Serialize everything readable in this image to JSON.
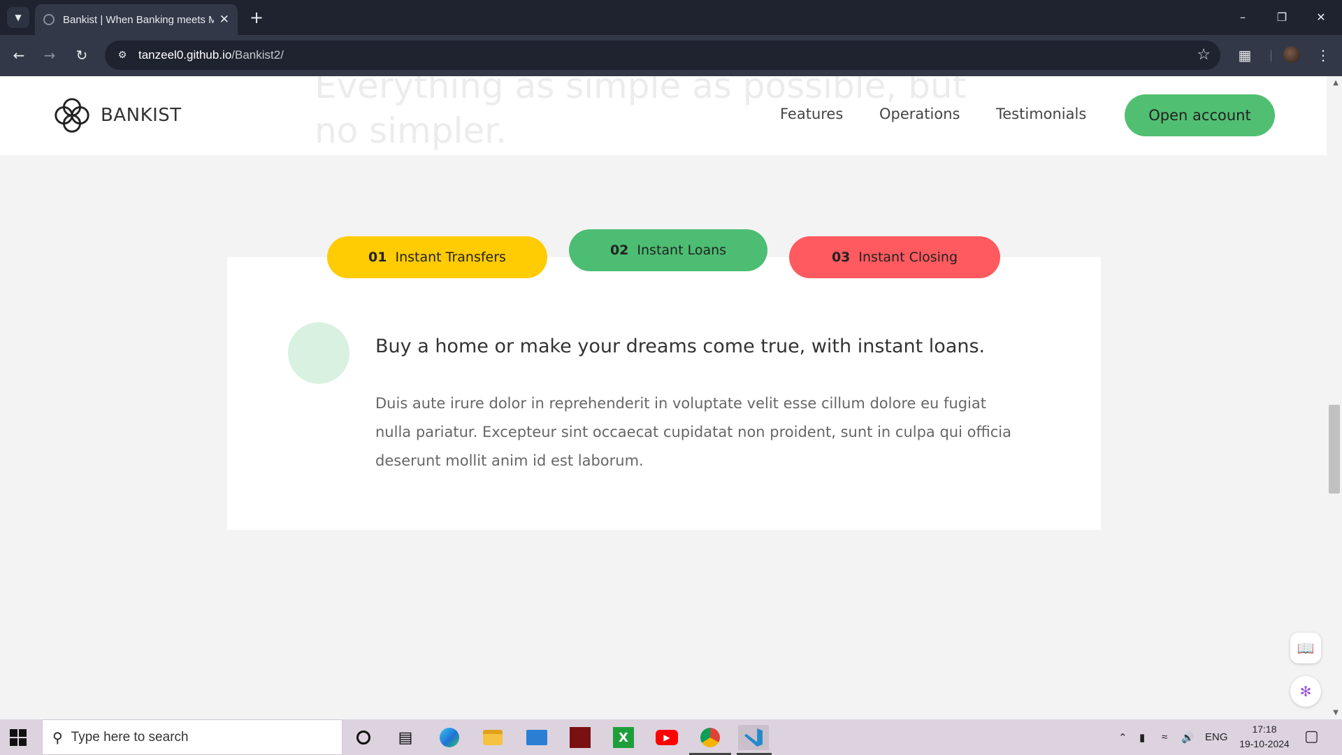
{
  "browser": {
    "tab_title": "Bankist | When Banking meets Minimalist",
    "url_host": "tanzeel0.github.io",
    "url_path": "/Bankist2/"
  },
  "header": {
    "ghost_heading": "Everything as simple as possible, but no simpler.",
    "brand_name": "BANKIST",
    "nav": [
      "Features",
      "Operations",
      "Testimonials"
    ],
    "cta_label": "Open account"
  },
  "operations": {
    "tabs": [
      {
        "num": "01",
        "label": "Instant Transfers",
        "color": "#ffcb03"
      },
      {
        "num": "02",
        "label": "Instant Loans",
        "color": "#4cbd72"
      },
      {
        "num": "03",
        "label": "Instant Closing",
        "color": "#ff5a5f"
      }
    ],
    "active_tab": 1,
    "heading": "Buy a home or make your dreams come true, with instant loans.",
    "body": "Duis aute irure dolor in reprehenderit in voluptate velit esse cillum dolore eu fugiat nulla pariatur. Excepteur sint occaecat cupidatat non proident, sunt in culpa qui officia deserunt mollit anim id est laborum."
  },
  "taskbar": {
    "search_placeholder": "Type here to search",
    "language": "ENG",
    "time": "17:18",
    "date": "19-10-2024",
    "apps": [
      "cortana-icon",
      "task-view-icon",
      "edge-icon",
      "file-explorer-icon",
      "mail-icon",
      "game-icon",
      "xbox-icon",
      "youtube-icon",
      "chrome-icon",
      "vscode-icon"
    ]
  },
  "colors": {
    "accent_green": "#51bf72",
    "yellow": "#ffcb03",
    "red": "#ff5a5f",
    "chrome_dark": "#1f2330"
  }
}
